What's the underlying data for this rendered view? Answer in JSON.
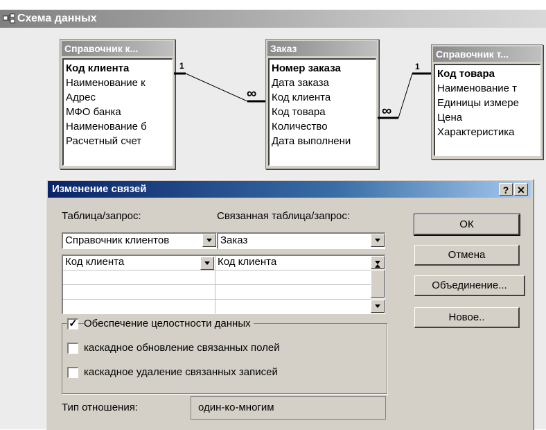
{
  "window": {
    "title": "Схема данных"
  },
  "tables": [
    {
      "title": "Справочник к...",
      "key": "Код клиента",
      "fields": [
        "Наименование к",
        "Адрес",
        "МФО банка",
        "Наименование б",
        "Расчетный счет"
      ]
    },
    {
      "title": "Заказ",
      "key": "Номер заказа",
      "fields": [
        "Дата заказа",
        "Код клиента",
        "Код товара",
        "Количество",
        "Дата выполнени"
      ]
    },
    {
      "title": "Справочник т...",
      "key": "Код товара",
      "fields": [
        "Наименование т",
        "Единицы измере",
        "Цена",
        "Характеристика"
      ]
    }
  ],
  "relations": [
    {
      "one": "1",
      "many": "∞"
    },
    {
      "one": "1",
      "many": "∞"
    }
  ],
  "dialog": {
    "title": "Изменение связей",
    "help_label": "?",
    "close_label": "✕",
    "table_label": "Таблица/запрос:",
    "related_label": "Связанная таблица/запрос:",
    "table_value": "Справочник клиентов",
    "related_value": "Заказ",
    "grid_rows": [
      {
        "left": "Код клиента",
        "right": "Код клиента"
      },
      {
        "left": "",
        "right": ""
      },
      {
        "left": "",
        "right": ""
      },
      {
        "left": "",
        "right": ""
      }
    ],
    "buttons": {
      "ok": "ОК",
      "cancel": "Отмена",
      "join": "Объединение...",
      "new": "Новое.."
    },
    "integrity_label": "Обеспечение целостности данных",
    "integrity_checked": true,
    "cascade_update_label": "каскадное обновление связанных полей",
    "cascade_update_checked": false,
    "cascade_delete_label": "каскадное удаление связанных записей",
    "cascade_delete_checked": false,
    "relation_type_label": "Тип отношения:",
    "relation_type_value": "один-ко-многим"
  },
  "colors": {
    "dialog_title": "#0a246a",
    "inactive_title": "#808080",
    "face": "#d4d0c8"
  }
}
